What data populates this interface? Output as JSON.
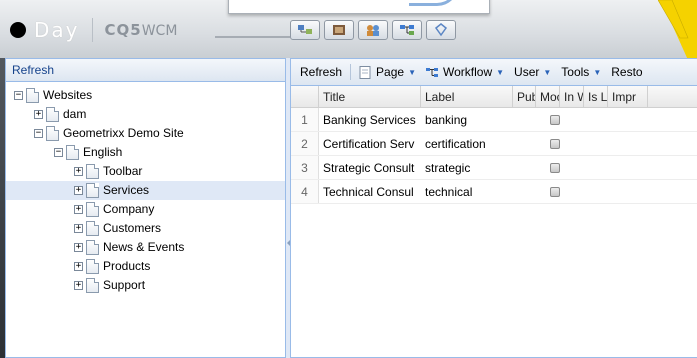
{
  "brand": {
    "company": "Day",
    "product_bold": "CQ5",
    "product_rest": "WCM"
  },
  "icons": [
    "site-admin-icon",
    "dam-icon",
    "users-icon",
    "workflow-icon",
    "tagging-icon"
  ],
  "colors": {
    "accent": "#99bbe8",
    "selection": "#dfe8f6",
    "corner": "#f5d200"
  },
  "left_panel": {
    "header": "Refresh",
    "tree": [
      {
        "label": "Websites",
        "depth": 0,
        "expander": "−",
        "selected": false
      },
      {
        "label": "dam",
        "depth": 1,
        "expander": "+",
        "selected": false
      },
      {
        "label": "Geometrixx Demo Site",
        "depth": 1,
        "expander": "−",
        "selected": false
      },
      {
        "label": "English",
        "depth": 2,
        "expander": "−",
        "selected": false
      },
      {
        "label": "Toolbar",
        "depth": 3,
        "expander": "+",
        "selected": false
      },
      {
        "label": "Services",
        "depth": 3,
        "expander": "+",
        "selected": true
      },
      {
        "label": "Company",
        "depth": 3,
        "expander": "+",
        "selected": false
      },
      {
        "label": "Customers",
        "depth": 3,
        "expander": "+",
        "selected": false
      },
      {
        "label": "News & Events",
        "depth": 3,
        "expander": "+",
        "selected": false
      },
      {
        "label": "Products",
        "depth": 3,
        "expander": "+",
        "selected": false
      },
      {
        "label": "Support",
        "depth": 3,
        "expander": "+",
        "selected": false
      }
    ]
  },
  "toolbar": {
    "refresh": "Refresh",
    "page": "Page",
    "workflow": "Workflow",
    "user": "User",
    "tools": "Tools",
    "restore": "Resto"
  },
  "grid": {
    "columns": [
      "",
      "Title",
      "Label",
      "Pub",
      "Moc",
      "In W",
      "Is Lc",
      "Impr"
    ],
    "rows": [
      {
        "num": "1",
        "title": "Banking Services",
        "label": "banking"
      },
      {
        "num": "2",
        "title": "Certification Serv",
        "label": "certification"
      },
      {
        "num": "3",
        "title": "Strategic Consult",
        "label": "strategic"
      },
      {
        "num": "4",
        "title": "Technical Consul",
        "label": "technical"
      }
    ]
  }
}
